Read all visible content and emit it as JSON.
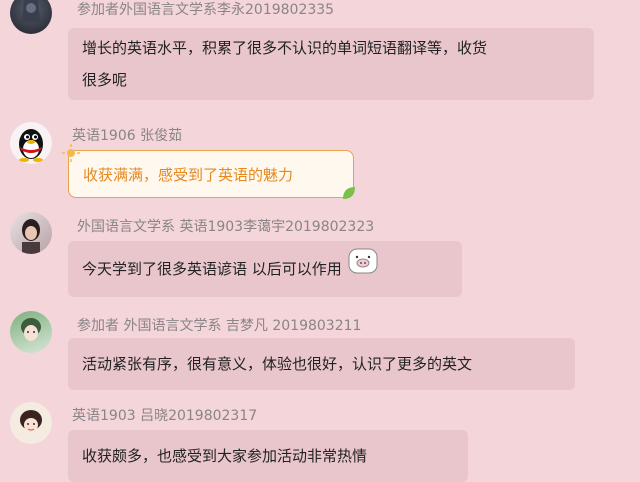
{
  "messages": [
    {
      "name": "参加者外国语言文学系李永2019802335",
      "text_line1": "增长的英语水平，积累了很多不认识的单词短语翻译等，收货",
      "text_line2": "很多呢",
      "avatar": "dark-photo-avatar"
    },
    {
      "name": "英语1906 张俊茹",
      "text": "收获满满，感受到了英语的魅力",
      "avatar": "qq-penguin-avatar"
    },
    {
      "name": "外国语言文学系 英语1903李蔼宇2019802323",
      "text": "今天学到了很多英语谚语  以后可以作用",
      "avatar": "girl-photo-avatar",
      "emoji": "pig-face-icon"
    },
    {
      "name": "参加者 外国语言文学系 吉梦凡 2019803211",
      "text": "活动紧张有序，很有意义，体验也很好，认识了更多的英文",
      "avatar": "anime-avatar"
    },
    {
      "name": "英语1903 吕晓2019802317",
      "text": "收获颇多，也感受到大家参加活动非常热情",
      "avatar": "cartoon-girl-avatar"
    }
  ],
  "colors": {
    "background": "#f3d5da",
    "bubble": "#e8c6cc",
    "special_bubble_border": "#e7a34b",
    "special_text": "#e6891f"
  }
}
